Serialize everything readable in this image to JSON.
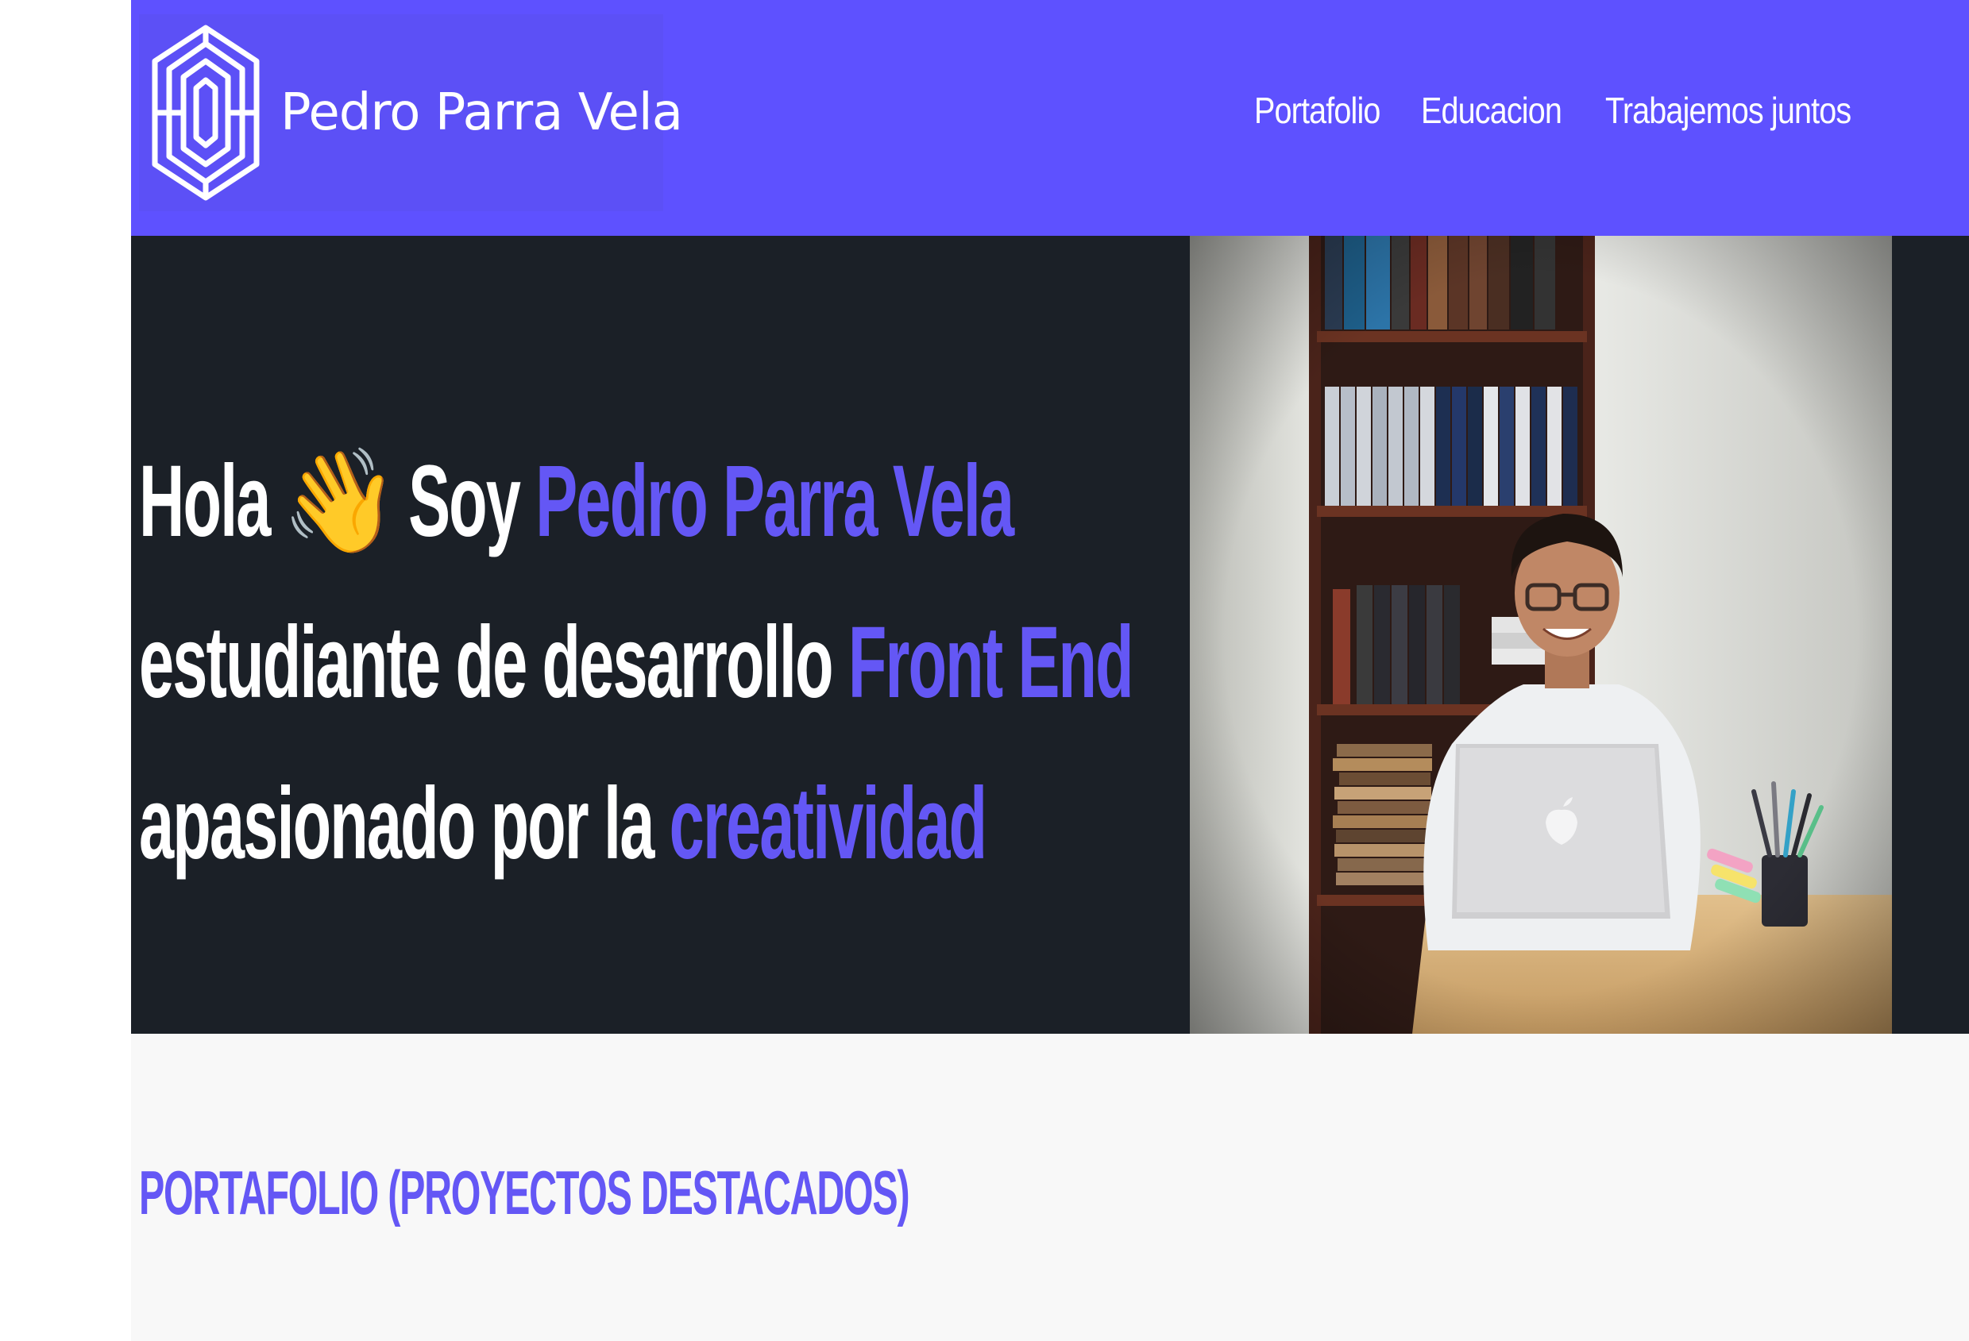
{
  "brand": {
    "name": "Pedro Parra Vela",
    "logo_icon": "maze-hexagon-icon"
  },
  "nav": {
    "items": [
      {
        "label": "Portafolio"
      },
      {
        "label": "Educacion"
      },
      {
        "label": "Trabajemos juntos"
      }
    ]
  },
  "hero": {
    "line1": {
      "text1": "Hola",
      "emoji": "👋",
      "text2": "Soy",
      "accent": "Pedro Parra Vela"
    },
    "line2": {
      "text": "estudiante de desarrollo",
      "accent": "Front End"
    },
    "line3": {
      "text": "apasionado por la",
      "accent": "creatividad"
    }
  },
  "portfolio": {
    "title": "PORTAFOLIO (PROYECTOS DESTACADOS)"
  },
  "colors": {
    "brand_purple": "#5e51ff",
    "accent_purple": "#6457f5",
    "hero_background": "#1b2027",
    "section_background": "#f8f8f8"
  }
}
